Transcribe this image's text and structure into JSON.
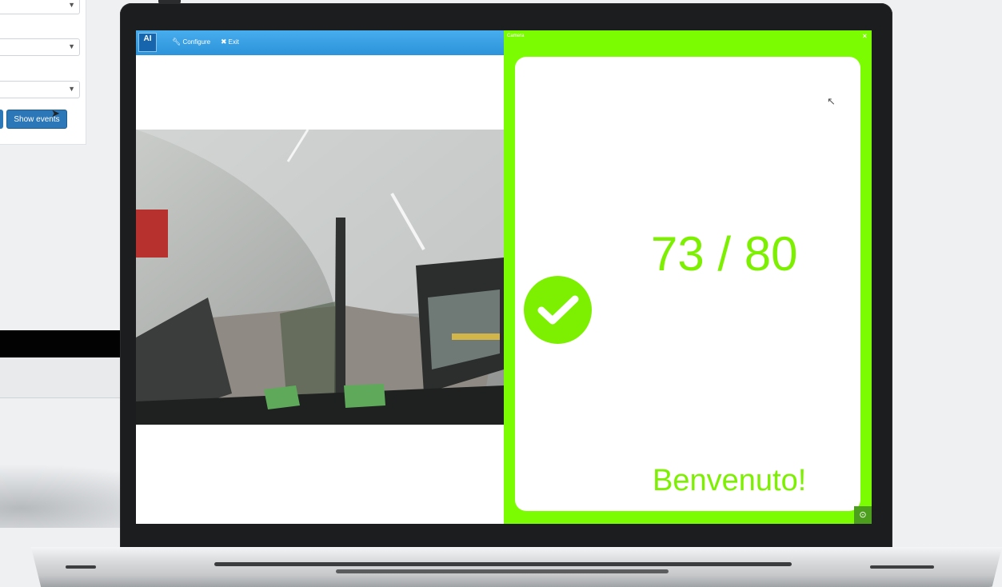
{
  "background_app": {
    "show_events_label": "Show events",
    "select_caret": "▼"
  },
  "app": {
    "logo_text": "AI",
    "configure_label": "Configure",
    "exit_label": "Exit",
    "configure_icon": "wrench-icon",
    "exit_icon": "close-icon"
  },
  "result": {
    "panel_title": "Camera",
    "close_symbol": "×",
    "count_text": "73 / 80",
    "welcome_text": "Benvenuto!",
    "status_icon": "checkmark-icon",
    "accent_color": "#7cfc00",
    "corner_button_symbol": "⊙"
  }
}
